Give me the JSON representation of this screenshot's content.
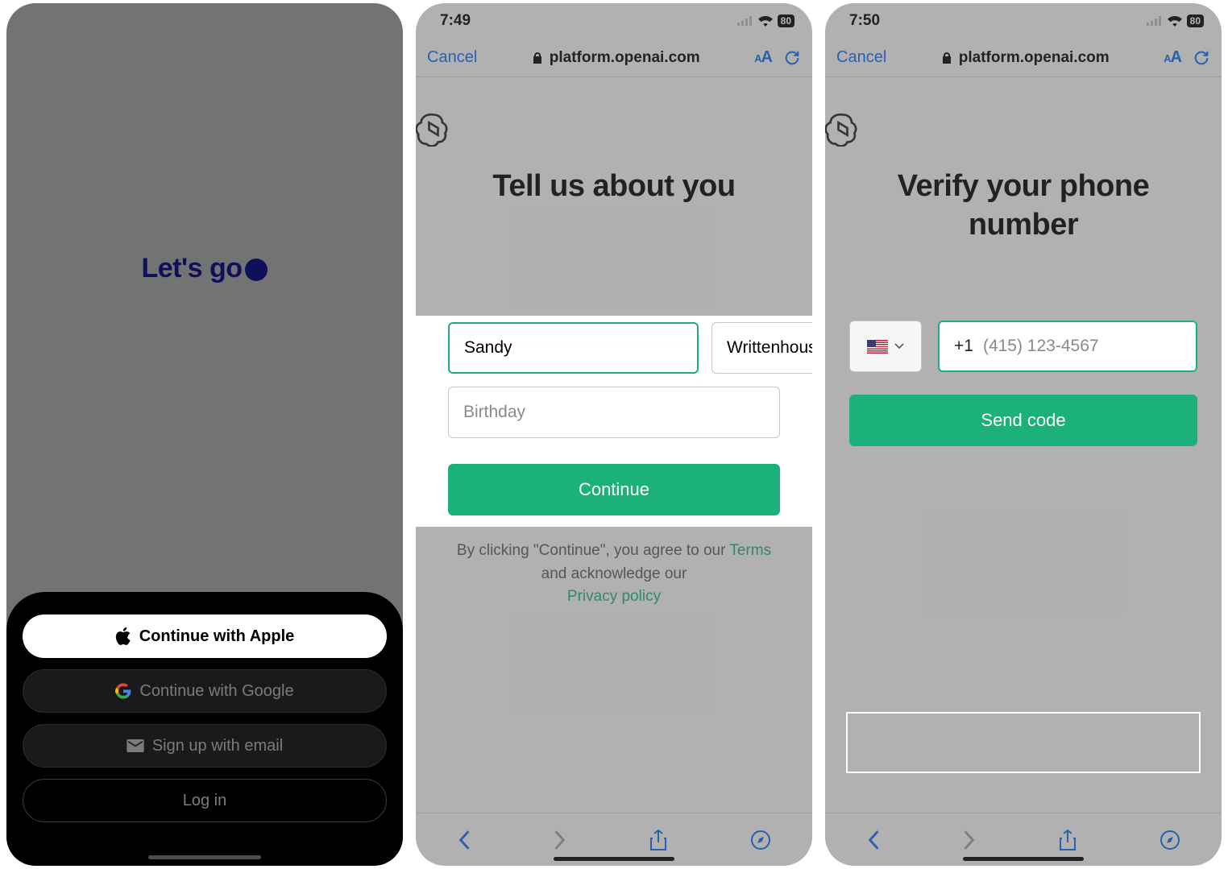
{
  "screens": {
    "welcome": {
      "headline": "Let's go",
      "buttons": {
        "apple": "Continue with Apple",
        "google": "Continue with Google",
        "email": "Sign up with email",
        "login": "Log in"
      }
    },
    "about": {
      "status": {
        "time": "7:49",
        "battery": "80"
      },
      "safari": {
        "cancel": "Cancel",
        "domain": "platform.openai.com"
      },
      "heading": "Tell us about you",
      "form": {
        "first_name": "Sandy",
        "last_name": "Writtenhous",
        "birthday_placeholder": "Birthday",
        "continue": "Continue"
      },
      "consent": {
        "line1_pre": "By clicking \"Continue\", you agree to our ",
        "terms": "Terms",
        "line1_mid": " and acknowledge our ",
        "privacy": "Privacy policy"
      }
    },
    "verify": {
      "status": {
        "time": "7:50",
        "battery": "80"
      },
      "safari": {
        "cancel": "Cancel",
        "domain": "platform.openai.com"
      },
      "heading": "Verify your phone number",
      "form": {
        "country_code": "+1",
        "phone_placeholder": "(415) 123-4567",
        "send": "Send code"
      }
    }
  }
}
